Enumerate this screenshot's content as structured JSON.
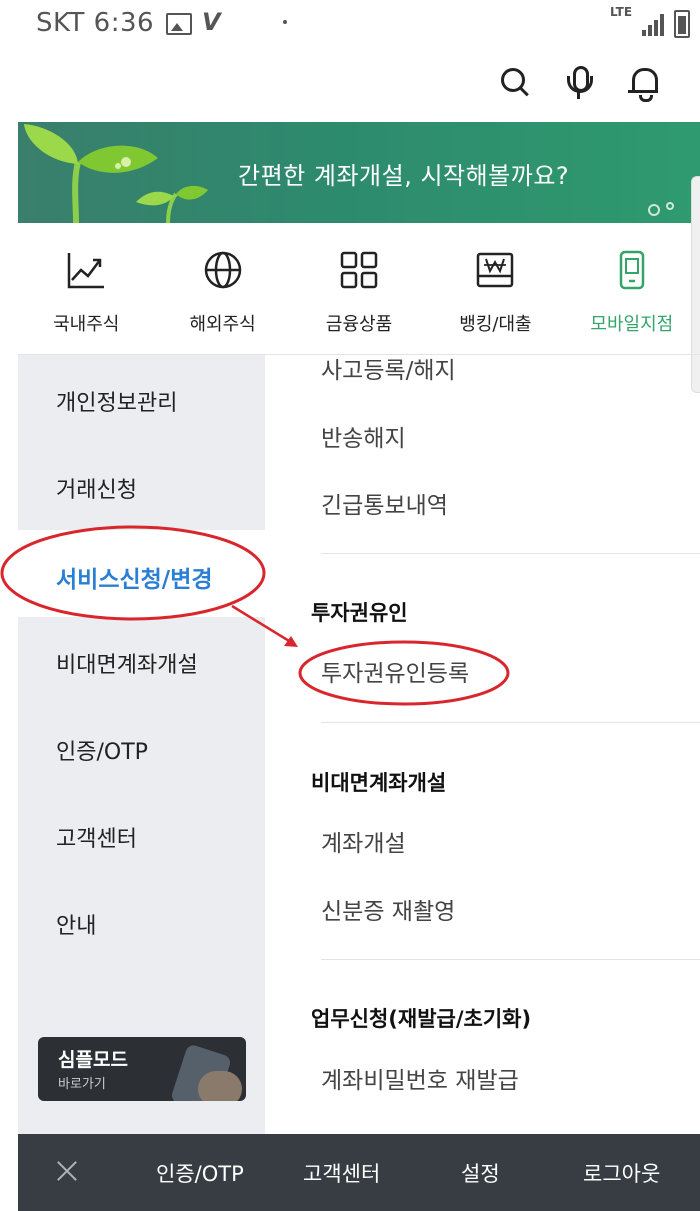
{
  "status_bar": {
    "carrier_time": "SKT 6:36",
    "network": "LTE"
  },
  "top_icons": [
    "search-icon",
    "microphone-icon",
    "bell-icon"
  ],
  "banner": {
    "text": "간편한 계좌개설, 시작해볼까요?"
  },
  "categories": [
    {
      "label": "국내주식",
      "icon": "line-chart-icon"
    },
    {
      "label": "해외주식",
      "icon": "globe-icon"
    },
    {
      "label": "금융상품",
      "icon": "grid-icon"
    },
    {
      "label": "뱅킹/대출",
      "icon": "won-bank-icon"
    },
    {
      "label": "모바일지점",
      "icon": "mobile-phone-icon",
      "active": true
    }
  ],
  "sidebar": {
    "items": [
      {
        "label": "개인정보관리"
      },
      {
        "label": "거래신청"
      },
      {
        "label": "서비스신청/변경",
        "active": true
      },
      {
        "label": "비대면계좌개설"
      },
      {
        "label": "인증/OTP"
      },
      {
        "label": "고객센터"
      },
      {
        "label": "안내"
      }
    ],
    "simple_mode": {
      "title": "심플모드",
      "subtitle": "바로가기"
    }
  },
  "content": {
    "partial_top": "사고등록/해지",
    "items_group1": [
      "반송해지",
      "긴급통보내역"
    ],
    "section_invest": {
      "title": "투자권유인",
      "items": [
        "투자권유인등록"
      ]
    },
    "section_nonface": {
      "title": "비대면계좌개설",
      "items": [
        "계좌개설",
        "신분증 재촬영"
      ]
    },
    "section_business": {
      "title": "업무신청(재발급/초기화)",
      "items": [
        "계좌비밀번호 재발급"
      ]
    }
  },
  "colors": {
    "accent_green": "#35a46a",
    "accent_blue": "#2a7fd4",
    "annotation_red": "#d9262c",
    "bottom_bar": "#383d44"
  },
  "bottom_bar": {
    "close_icon": "close-icon",
    "items": [
      "인증/OTP",
      "고객센터",
      "설정",
      "로그아웃"
    ]
  }
}
